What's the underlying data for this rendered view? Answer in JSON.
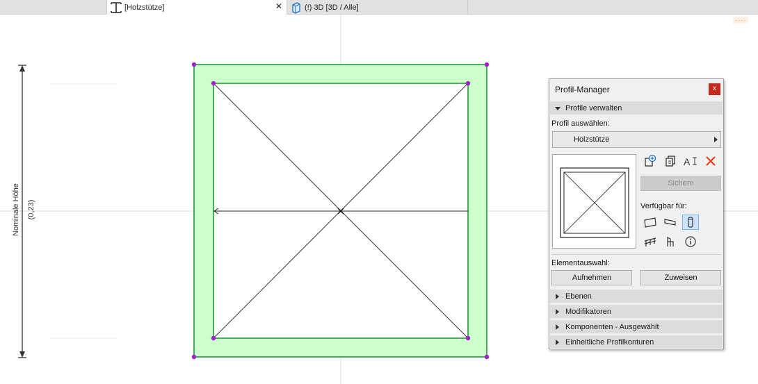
{
  "tabs": [
    {
      "label": "[Holzstütze]",
      "icon": "column-profile-icon",
      "active": true,
      "close": "✕"
    },
    {
      "label": "(!) 3D [3D / Alle]",
      "icon": "3d-window-icon",
      "active": false
    }
  ],
  "corner_indicator": "----",
  "dimension": {
    "label": "Nominale Höhe",
    "value": "(0,23)"
  },
  "colors": {
    "profile_fill": "#ccffcc",
    "profile_stroke": "#1f9a3a",
    "vertex": "#a020c8",
    "close_button": "#c42b1c"
  },
  "palette": {
    "title": "Profil-Manager",
    "close_label": "x",
    "section_manage": "Profile verwalten",
    "select_label": "Profil auswählen:",
    "selected_profile": "Holzstütze",
    "tool_icons": [
      "new-profile-icon",
      "duplicate-profile-icon",
      "rename-icon",
      "delete-icon"
    ],
    "save_label": "Sichern",
    "available_label": "Verfügbar für:",
    "available_icons": [
      "wall-icon",
      "beam-icon",
      "column-icon",
      "railing-icon",
      "chair-object-icon",
      "info-icon"
    ],
    "element_label": "Elementauswahl:",
    "pick_label": "Aufnehmen",
    "assign_label": "Zuweisen",
    "sections": [
      "Ebenen",
      "Modifikatoren",
      "Komponenten - Ausgewählt",
      "Einheitliche Profilkonturen"
    ]
  }
}
